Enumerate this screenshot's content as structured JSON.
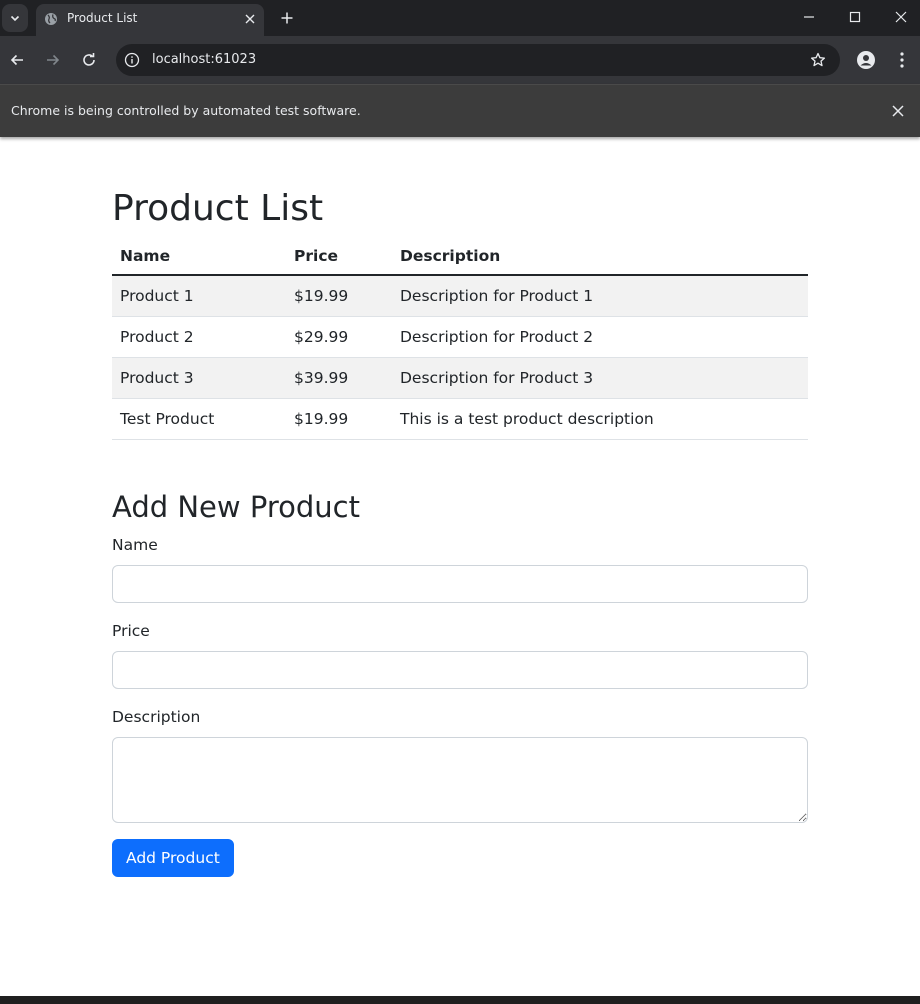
{
  "browser": {
    "tab_title": "Product List",
    "url": "localhost:61023",
    "infobar_message": "Chrome is being controlled by automated test software."
  },
  "page": {
    "title": "Product List",
    "table": {
      "headers": [
        "Name",
        "Price",
        "Description"
      ],
      "rows": [
        [
          "Product 1",
          "$19.99",
          "Description for Product 1"
        ],
        [
          "Product 2",
          "$29.99",
          "Description for Product 2"
        ],
        [
          "Product 3",
          "$39.99",
          "Description for Product 3"
        ],
        [
          "Test Product",
          "$19.99",
          "This is a test product description"
        ]
      ]
    },
    "form": {
      "heading": "Add New Product",
      "name_label": "Name",
      "name_value": "",
      "price_label": "Price",
      "price_value": "",
      "description_label": "Description",
      "description_value": "",
      "submit_label": "Add Product"
    }
  },
  "colors": {
    "primary": "#0d6efd",
    "stripe": "#f2f2f2",
    "text": "#212529",
    "chrome_dark": "#202124",
    "chrome_toolbar": "#35363a"
  }
}
